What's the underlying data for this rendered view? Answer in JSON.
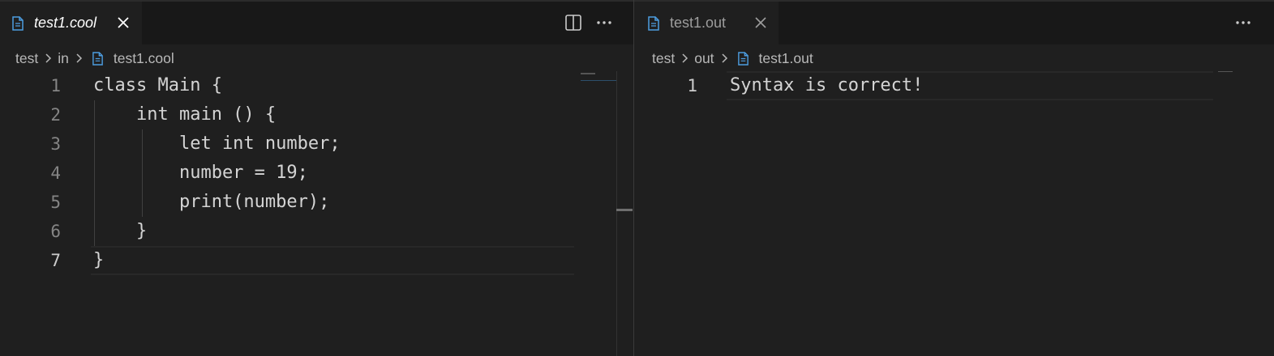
{
  "left_editor": {
    "tab": {
      "label": "test1.cool",
      "icon": "file-icon",
      "close_icon": "close-icon"
    },
    "actions": {
      "split": "split-editor-icon",
      "more": "more-actions-icon"
    },
    "breadcrumb": [
      "test",
      "in",
      "test1.cool"
    ],
    "lines": [
      {
        "num": "1",
        "text": "class Main {"
      },
      {
        "num": "2",
        "text": "    int main () {"
      },
      {
        "num": "3",
        "text": "        let int number;"
      },
      {
        "num": "4",
        "text": "        number = 19;"
      },
      {
        "num": "5",
        "text": "        print(number);"
      },
      {
        "num": "6",
        "text": "    }"
      },
      {
        "num": "7",
        "text": "}"
      }
    ],
    "current_line": "7"
  },
  "right_editor": {
    "tab": {
      "label": "test1.out",
      "icon": "file-icon",
      "close_icon": "close-icon"
    },
    "actions": {
      "more": "more-actions-icon"
    },
    "breadcrumb": [
      "test",
      "out",
      "test1.out"
    ],
    "lines": [
      {
        "num": "1",
        "text": "Syntax is correct!"
      }
    ],
    "current_line": "1"
  },
  "colors": {
    "editor_bg": "#1f1f1f",
    "tabbar_bg": "#181818",
    "file_icon": "#4d9de0",
    "text": "#d4d4d4",
    "line_number": "#858585"
  }
}
